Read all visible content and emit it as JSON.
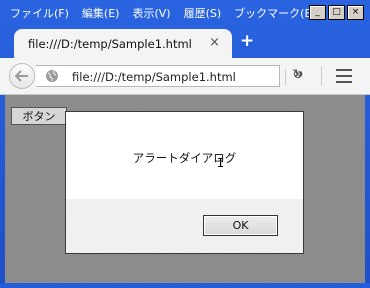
{
  "menubar": {
    "items": [
      "ファイル(F)",
      "編集(E)",
      "表示(V)",
      "履歴(S)",
      "ブックマーク(B)"
    ]
  },
  "window_controls": {
    "minimize": "_",
    "maximize": "□",
    "close": "×"
  },
  "tab": {
    "title": "file:///D:/temp/Sample1.html",
    "close": "×",
    "new_tab": "+"
  },
  "navbar": {
    "url": "file:///D:/temp/Sample1.html",
    "reload": "↻",
    "overflow": "»"
  },
  "page": {
    "button_label": "ボタン"
  },
  "dialog": {
    "message": "アラートダイアログ",
    "ok_label": "OK",
    "cursor": "I"
  },
  "icons": [
    "back-arrow-icon",
    "globe-icon",
    "reload-icon",
    "overflow-icon",
    "hamburger-menu-icon",
    "close-icon",
    "plus-icon"
  ]
}
